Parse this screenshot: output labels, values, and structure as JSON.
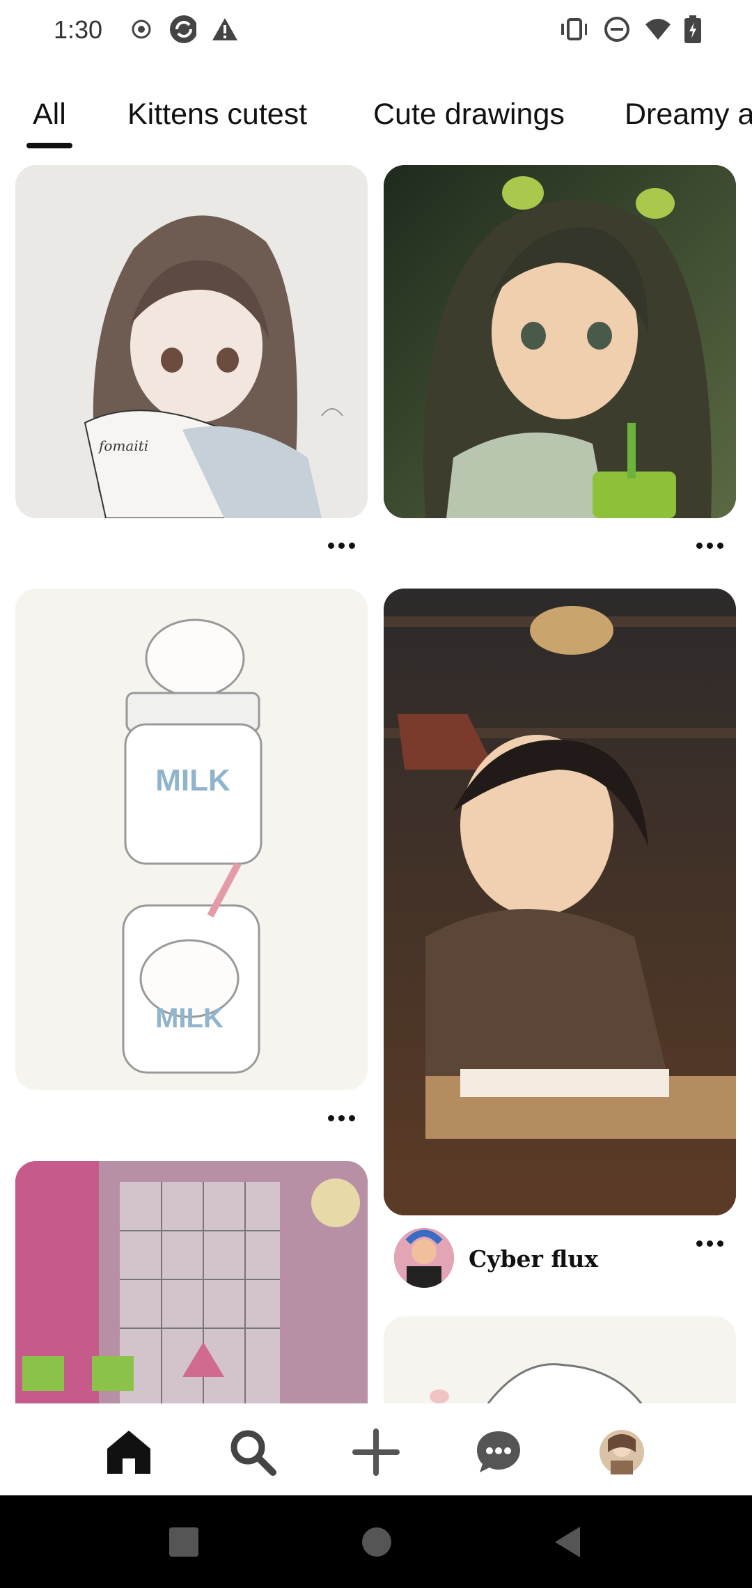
{
  "status_bar": {
    "time": "1:30",
    "left_icons": [
      "record-icon",
      "sync-icon",
      "warning-icon"
    ],
    "right_icons": [
      "vibrate-icon",
      "do-not-disturb-icon",
      "wifi-icon",
      "battery-charging-icon"
    ]
  },
  "tabs": [
    {
      "label": "All",
      "selected": true
    },
    {
      "label": "Kittens cutest",
      "selected": false
    },
    {
      "label": "Cute drawings",
      "selected": false
    },
    {
      "label": "Dreamy a",
      "selected": false
    }
  ],
  "pins": [
    {
      "id": "pin-1",
      "description": "anime girl sketch with scarf"
    },
    {
      "id": "pin-2",
      "description": "anime girl with green drink"
    },
    {
      "id": "pin-3",
      "description": "kitten milk bottles",
      "text_lines": [
        "MILK",
        "MILK"
      ]
    },
    {
      "id": "pin-4",
      "description": "anime girl studying at desk",
      "author": "Cyber flux"
    },
    {
      "id": "pin-5",
      "description": "pink desk organizer"
    },
    {
      "id": "pin-6",
      "description": "cat drawing partial"
    }
  ],
  "bottom_nav": [
    "home-icon",
    "search-icon",
    "create-icon",
    "messages-icon",
    "profile-avatar"
  ],
  "colors": {
    "accent": "#111111",
    "background": "#ffffff"
  }
}
